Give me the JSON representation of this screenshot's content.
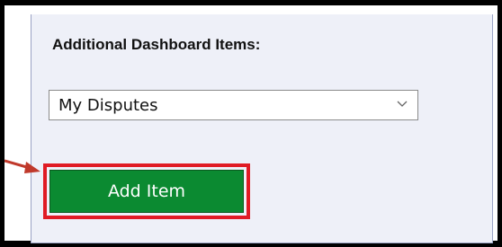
{
  "panel": {
    "heading": "Additional Dashboard Items:",
    "dropdown": {
      "selected": "My Disputes",
      "chevron_icon": "chevron-down-icon"
    },
    "add_button_label": "Add Item"
  },
  "annotations": {
    "highlight_color": "#e01b24",
    "arrow_color": "#c0392b"
  },
  "colors": {
    "button_bg": "#0b8a31",
    "panel_bg": "#eef0f8",
    "panel_border": "#9aa3c4"
  }
}
